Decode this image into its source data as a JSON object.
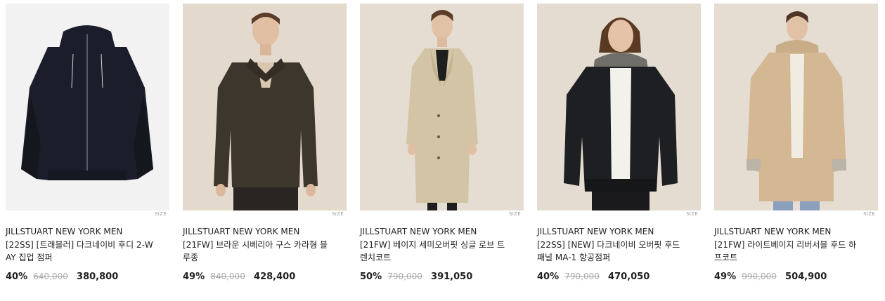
{
  "products": [
    {
      "brand": "JILLSTUART NEW YORK MEN",
      "name": "[22SS] [트래블러] 다크네이비 후디 2-WAY 집업 점퍼",
      "discount": "40%",
      "original_price": "640,000",
      "sale_price": "380,800",
      "size_tag": "SIZE",
      "bg_color": "#f2f2f2",
      "garment_color": "#1b1e2a"
    },
    {
      "brand": "JILLSTUART NEW YORK MEN",
      "name": "[21FW] 브라운 시베리아 구스 카라형 블루종",
      "discount": "49%",
      "original_price": "840,000",
      "sale_price": "428,400",
      "size_tag": "SIZE",
      "bg_color": "#e3d9cc",
      "garment_color": "#3d362d"
    },
    {
      "brand": "JILLSTUART NEW YORK MEN",
      "name": "[21FW] 베이지 세미오버핏 싱글 로브 트렌치코트",
      "discount": "50%",
      "original_price": "790,000",
      "sale_price": "391,050",
      "size_tag": "SIZE",
      "bg_color": "#e6ddd2",
      "garment_color": "#d2c4a4"
    },
    {
      "brand": "JILLSTUART NEW YORK MEN",
      "name": "[22SS] [NEW] 다크네이비 오버핏 후드 패널 MA-1 항공점퍼",
      "discount": "40%",
      "original_price": "790,000",
      "sale_price": "470,050",
      "size_tag": "SIZE",
      "bg_color": "#e5dcd1",
      "garment_color": "#1e1f22"
    },
    {
      "brand": "JILLSTUART NEW YORK MEN",
      "name": "[21FW] 라이트베이지 리버서블 후드 하프코트",
      "discount": "49%",
      "original_price": "990,000",
      "sale_price": "504,900",
      "size_tag": "SIZE",
      "bg_color": "#e6ddd2",
      "garment_color": "#d4b894"
    }
  ]
}
